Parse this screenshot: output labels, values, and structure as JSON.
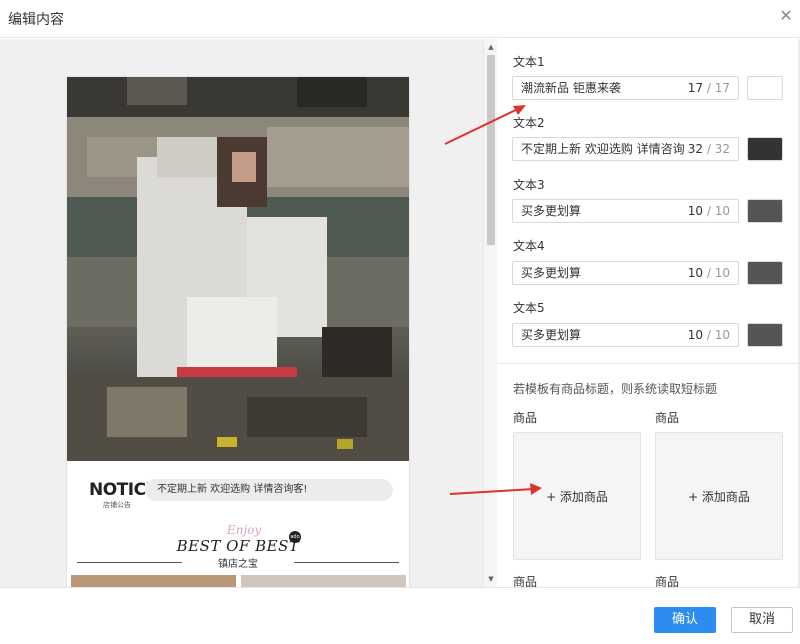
{
  "dialog": {
    "title": "编辑内容",
    "close_icon": "close-icon"
  },
  "preview": {
    "notice_logo": "NOTICE",
    "notice_sub": "店铺公告",
    "notice_text": "不定期上新 欢迎选购 详情咨询客!",
    "best_script": "Enjoy",
    "best_title": "BEST OF BEST",
    "best_badge": "ado",
    "best_sub": "镇店之宝"
  },
  "texts": [
    {
      "label": "文本1",
      "value": "潮流新品 钜惠来袭",
      "count": "17",
      "max": "17",
      "color": "#ffffff"
    },
    {
      "label": "文本2",
      "value": "不定期上新 欢迎选购 详情咨询",
      "count": "32",
      "max": "32",
      "color": "#333333"
    },
    {
      "label": "文本3",
      "value": "买多更划算",
      "count": "10",
      "max": "10",
      "color": "#555555"
    },
    {
      "label": "文本4",
      "value": "买多更划算",
      "count": "10",
      "max": "10",
      "color": "#555555"
    },
    {
      "label": "文本5",
      "value": "买多更划算",
      "count": "10",
      "max": "10",
      "color": "#555555"
    }
  ],
  "count_sep": " / ",
  "products": {
    "hint": "若模板有商品标题，则系统读取短标题",
    "label": "商品",
    "add_label": "+ 添加商品"
  },
  "footer": {
    "confirm": "确认",
    "cancel": "取消"
  },
  "colors": {
    "primary": "#2d8cf0",
    "arrow": "#e0322c"
  }
}
